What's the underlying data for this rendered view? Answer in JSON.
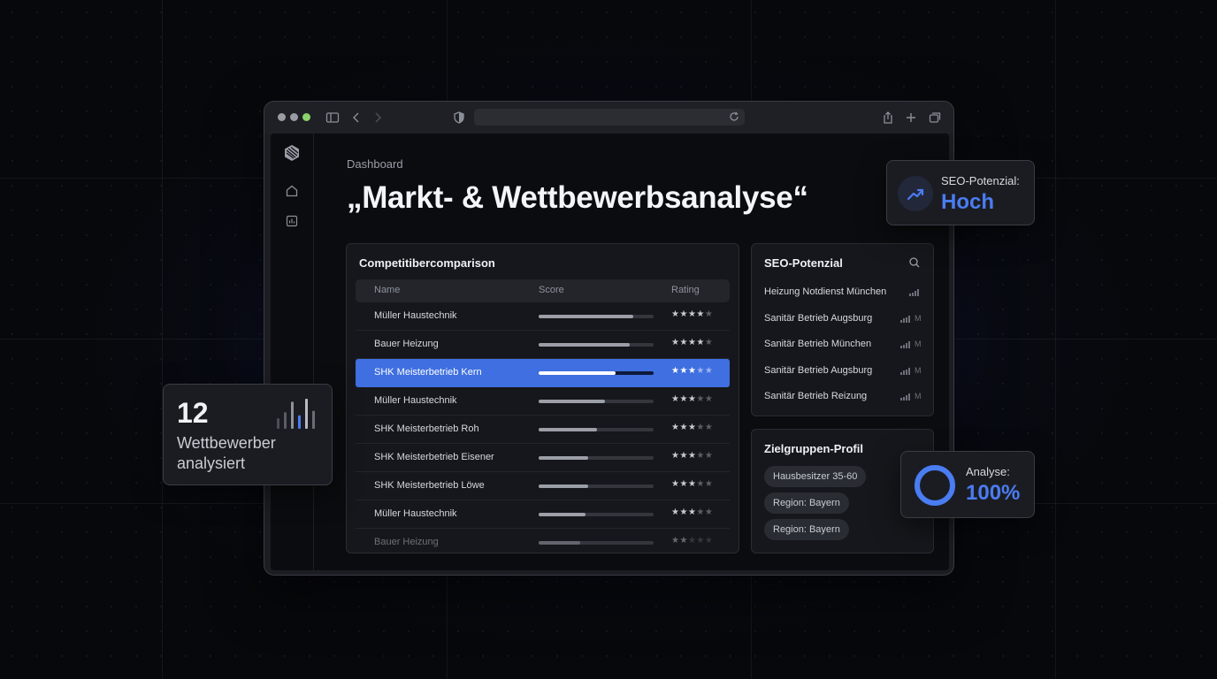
{
  "browser": {
    "traffic_lights": [
      "#9a9ca3",
      "#9a9ca3",
      "#8ad26d"
    ]
  },
  "sidebar": {
    "icons": [
      "logo-icon",
      "home-icon",
      "chart-icon"
    ]
  },
  "main": {
    "breadcrumb": "Dashboard",
    "title": "„Markt- & Wettbewerbsanalyse“"
  },
  "competitors": {
    "title": "Competitibercomparison",
    "columns": [
      "Name",
      "Score",
      "Rating"
    ],
    "rows": [
      {
        "name": "Müller Haustechnik",
        "score": 0.82,
        "rating": 4
      },
      {
        "name": "Bauer Heizung",
        "score": 0.79,
        "rating": 4
      },
      {
        "name": "SHK Meisterbetrieb Kern",
        "score": 0.67,
        "rating": 3,
        "selected": true
      },
      {
        "name": "Müller Haustechnik",
        "score": 0.58,
        "rating": 3
      },
      {
        "name": "SHK Meisterbetrieb Roh",
        "score": 0.51,
        "rating": 3
      },
      {
        "name": "SHK Meisterbetrieb Eisener",
        "score": 0.43,
        "rating": 3
      },
      {
        "name": "SHK Meisterbetrieb Löwe",
        "score": 0.43,
        "rating": 3
      },
      {
        "name": "Müller Haustechnik",
        "score": 0.41,
        "rating": 3
      },
      {
        "name": "Bauer Heizung",
        "score": 0.36,
        "rating": 2
      }
    ]
  },
  "seo": {
    "title": "SEO-Potenzial",
    "items": [
      {
        "label": "Heizung Notdienst München",
        "suffix": ""
      },
      {
        "label": "Sanitär Betrieb Augsburg",
        "suffix": "M"
      },
      {
        "label": "Sanitär Betrieb München",
        "suffix": "M"
      },
      {
        "label": "Sanitär Betrieb Augsburg",
        "suffix": "M"
      },
      {
        "label": "Sanitär Betrieb Reizung",
        "suffix": "M"
      }
    ]
  },
  "audience": {
    "title": "Zielgruppen-Profil",
    "chips": [
      "Hausbesitzer 35-60",
      "Region: Bayern",
      "Region: Bayern"
    ]
  },
  "badge_seo": {
    "label": "SEO-Potenzial:",
    "value": "Hoch",
    "accent": "#4a7cf2"
  },
  "badge_competitors": {
    "count": "12",
    "label_line1": "Wettbewerber",
    "label_line2": "analysiert",
    "bars": [
      0.35,
      0.55,
      0.9,
      0.45,
      1.0,
      0.6
    ]
  },
  "badge_analysis": {
    "label": "Analyse:",
    "value": "100%",
    "progress": 1.0
  }
}
